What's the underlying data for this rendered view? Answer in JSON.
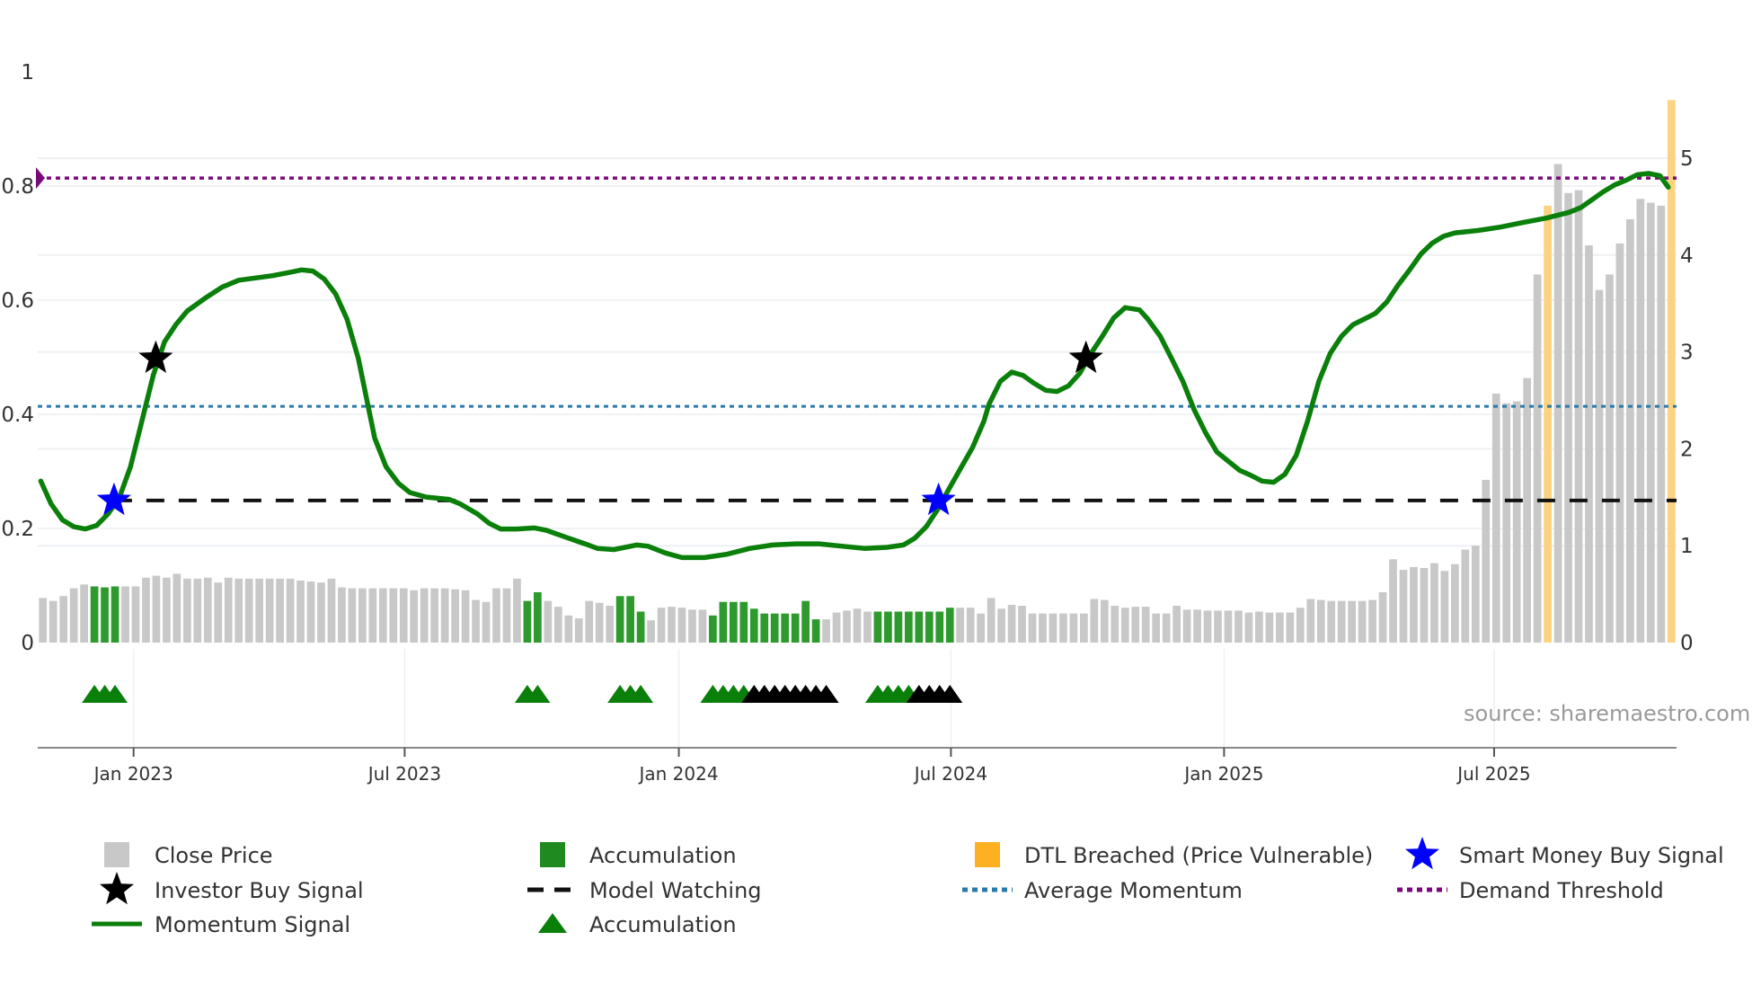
{
  "chart_data": {
    "type": "bar+line",
    "title": "",
    "x_unit": "week index",
    "x_ticks": [
      {
        "label": "Jan 2023",
        "x": 8.8
      },
      {
        "label": "Jul 2023",
        "x": 35.1
      },
      {
        "label": "Jan 2024",
        "x": 61.7
      },
      {
        "label": "Jul 2024",
        "x": 88.1
      },
      {
        "label": "Jan 2025",
        "x": 114.6
      },
      {
        "label": "Jul 2025",
        "x": 140.8
      }
    ],
    "left_axis": {
      "ylim": [
        0,
        1
      ],
      "ticks": [
        "0",
        "0.2",
        "0.4",
        "0.6",
        "0.8",
        "1"
      ],
      "tick_values": [
        0,
        0.2,
        0.4,
        0.6,
        0.8,
        1
      ]
    },
    "right_axis": {
      "ylim": [
        0,
        5.6
      ],
      "ticks": [
        "0",
        "1",
        "2",
        "3",
        "4",
        "5"
      ],
      "tick_values": [
        0,
        1,
        2,
        3,
        4,
        5
      ]
    },
    "bars": {
      "values": [
        0.46,
        0.43,
        0.48,
        0.56,
        0.6,
        0.58,
        0.57,
        0.58,
        0.58,
        0.58,
        0.67,
        0.69,
        0.67,
        0.71,
        0.66,
        0.66,
        0.67,
        0.62,
        0.67,
        0.66,
        0.66,
        0.66,
        0.66,
        0.66,
        0.66,
        0.64,
        0.63,
        0.62,
        0.66,
        0.57,
        0.56,
        0.56,
        0.56,
        0.56,
        0.56,
        0.56,
        0.54,
        0.56,
        0.56,
        0.56,
        0.55,
        0.54,
        0.44,
        0.42,
        0.56,
        0.56,
        0.66,
        0.43,
        0.52,
        0.43,
        0.37,
        0.28,
        0.25,
        0.43,
        0.41,
        0.38,
        0.48,
        0.48,
        0.32,
        0.23,
        0.36,
        0.37,
        0.36,
        0.34,
        0.34,
        0.28,
        0.42,
        0.42,
        0.42,
        0.35,
        0.3,
        0.3,
        0.3,
        0.3,
        0.43,
        0.24,
        0.24,
        0.31,
        0.33,
        0.35,
        0.32,
        0.32,
        0.32,
        0.32,
        0.32,
        0.32,
        0.32,
        0.32,
        0.36,
        0.36,
        0.36,
        0.3,
        0.46,
        0.35,
        0.39,
        0.38,
        0.3,
        0.3,
        0.3,
        0.3,
        0.3,
        0.3,
        0.45,
        0.44,
        0.38,
        0.36,
        0.37,
        0.37,
        0.3,
        0.3,
        0.38,
        0.34,
        0.34,
        0.33,
        0.33,
        0.33,
        0.33,
        0.31,
        0.32,
        0.31,
        0.31,
        0.31,
        0.36,
        0.45,
        0.44,
        0.43,
        0.43,
        0.43,
        0.43,
        0.44,
        0.52,
        0.86,
        0.75,
        0.78,
        0.77,
        0.82,
        0.74,
        0.81,
        0.96,
        1.0,
        1.68,
        2.57,
        2.47,
        2.49,
        2.73,
        3.8,
        4.51,
        4.94,
        4.64,
        4.67,
        4.1,
        3.64,
        3.8,
        4.12,
        4.37,
        4.58,
        4.54,
        4.51,
        5.6
      ],
      "accumulation_idx": [
        5,
        6,
        7,
        47,
        48,
        56,
        57,
        58,
        65,
        66,
        67,
        68,
        69,
        70,
        71,
        72,
        73,
        74,
        75,
        81,
        82,
        83,
        84,
        85,
        86,
        87,
        88
      ],
      "dtl_breached_idx": [
        146,
        158
      ]
    },
    "accumulation_markers": {
      "green_idx": [
        5,
        6,
        7,
        47,
        48,
        56,
        57,
        58,
        65,
        66,
        67,
        68,
        81,
        82,
        83,
        84
      ],
      "black_idx": [
        69,
        70,
        71,
        72,
        73,
        74,
        75,
        76,
        85,
        86,
        87,
        88
      ]
    },
    "momentum": [
      [
        -0.2,
        0.283
      ],
      [
        0.8,
        0.243
      ],
      [
        1.9,
        0.215
      ],
      [
        3.0,
        0.203
      ],
      [
        4.1,
        0.199
      ],
      [
        5.2,
        0.205
      ],
      [
        6.3,
        0.225
      ],
      [
        7.4,
        0.253
      ],
      [
        8.5,
        0.308
      ],
      [
        9.6,
        0.388
      ],
      [
        10.7,
        0.468
      ],
      [
        11.8,
        0.527
      ],
      [
        12.9,
        0.557
      ],
      [
        14.0,
        0.581
      ],
      [
        15.7,
        0.603
      ],
      [
        17.4,
        0.623
      ],
      [
        19.0,
        0.635
      ],
      [
        20.7,
        0.639
      ],
      [
        22.3,
        0.643
      ],
      [
        24.0,
        0.649
      ],
      [
        25.1,
        0.653
      ],
      [
        26.2,
        0.651
      ],
      [
        27.3,
        0.637
      ],
      [
        28.4,
        0.611
      ],
      [
        29.5,
        0.567
      ],
      [
        30.6,
        0.498
      ],
      [
        32.2,
        0.358
      ],
      [
        33.3,
        0.308
      ],
      [
        34.5,
        0.279
      ],
      [
        35.6,
        0.263
      ],
      [
        37.2,
        0.255
      ],
      [
        39.4,
        0.251
      ],
      [
        40.5,
        0.243
      ],
      [
        42.2,
        0.225
      ],
      [
        43.3,
        0.209
      ],
      [
        44.4,
        0.199
      ],
      [
        46.0,
        0.199
      ],
      [
        47.7,
        0.201
      ],
      [
        48.8,
        0.197
      ],
      [
        51.0,
        0.183
      ],
      [
        52.6,
        0.173
      ],
      [
        53.8,
        0.165
      ],
      [
        55.4,
        0.163
      ],
      [
        57.6,
        0.171
      ],
      [
        58.7,
        0.169
      ],
      [
        60.4,
        0.157
      ],
      [
        62.0,
        0.149
      ],
      [
        64.2,
        0.149
      ],
      [
        66.4,
        0.155
      ],
      [
        68.6,
        0.165
      ],
      [
        70.8,
        0.171
      ],
      [
        73.1,
        0.173
      ],
      [
        75.3,
        0.173
      ],
      [
        77.5,
        0.169
      ],
      [
        79.7,
        0.165
      ],
      [
        81.9,
        0.167
      ],
      [
        83.5,
        0.171
      ],
      [
        84.6,
        0.183
      ],
      [
        85.7,
        0.203
      ],
      [
        86.8,
        0.233
      ],
      [
        87.9,
        0.269
      ],
      [
        89.0,
        0.304
      ],
      [
        90.2,
        0.342
      ],
      [
        91.3,
        0.388
      ],
      [
        91.8,
        0.418
      ],
      [
        92.9,
        0.458
      ],
      [
        94.0,
        0.474
      ],
      [
        95.1,
        0.468
      ],
      [
        96.2,
        0.454
      ],
      [
        97.3,
        0.442
      ],
      [
        98.4,
        0.44
      ],
      [
        99.5,
        0.45
      ],
      [
        100.6,
        0.472
      ],
      [
        101.7,
        0.507
      ],
      [
        102.8,
        0.537
      ],
      [
        103.9,
        0.569
      ],
      [
        105.0,
        0.587
      ],
      [
        106.4,
        0.583
      ],
      [
        107.2,
        0.567
      ],
      [
        108.4,
        0.537
      ],
      [
        109.5,
        0.498
      ],
      [
        110.6,
        0.458
      ],
      [
        111.7,
        0.408
      ],
      [
        112.8,
        0.368
      ],
      [
        113.9,
        0.334
      ],
      [
        115.0,
        0.318
      ],
      [
        116.1,
        0.302
      ],
      [
        117.2,
        0.293
      ],
      [
        118.3,
        0.283
      ],
      [
        119.4,
        0.281
      ],
      [
        120.5,
        0.295
      ],
      [
        121.6,
        0.328
      ],
      [
        122.7,
        0.388
      ],
      [
        123.8,
        0.458
      ],
      [
        124.9,
        0.507
      ],
      [
        126.0,
        0.537
      ],
      [
        127.1,
        0.557
      ],
      [
        128.2,
        0.567
      ],
      [
        129.3,
        0.577
      ],
      [
        130.4,
        0.597
      ],
      [
        131.5,
        0.627
      ],
      [
        132.6,
        0.653
      ],
      [
        133.7,
        0.681
      ],
      [
        134.8,
        0.7
      ],
      [
        135.9,
        0.712
      ],
      [
        137.0,
        0.718
      ],
      [
        139.2,
        0.722
      ],
      [
        141.4,
        0.728
      ],
      [
        143.6,
        0.736
      ],
      [
        145.9,
        0.744
      ],
      [
        148.1,
        0.754
      ],
      [
        149.2,
        0.762
      ],
      [
        150.3,
        0.776
      ],
      [
        151.4,
        0.79
      ],
      [
        152.5,
        0.802
      ],
      [
        153.6,
        0.81
      ],
      [
        154.7,
        0.82
      ],
      [
        155.8,
        0.822
      ],
      [
        156.9,
        0.818
      ],
      [
        157.7,
        0.798
      ]
    ],
    "reference_lines": {
      "demand_threshold": 0.814,
      "average_momentum": 0.414,
      "model_watching": 0.249
    },
    "smart_money_buy_signals": [
      [
        6.9,
        0.249
      ],
      [
        86.9,
        0.249
      ]
    ],
    "investor_buy_signals": [
      [
        10.95,
        0.498
      ],
      [
        101.2,
        0.498
      ]
    ],
    "annotation": "source: sharemaestro.com",
    "legend": [
      {
        "label": "Close Price",
        "icon": "gray-square"
      },
      {
        "label": "Accumulation",
        "icon": "green-square"
      },
      {
        "label": "DTL Breached (Price Vulnerable)",
        "icon": "orange-square"
      },
      {
        "label": "Smart Money Buy Signal",
        "icon": "blue-star"
      },
      {
        "label": "Investor Buy Signal",
        "icon": "black-star"
      },
      {
        "label": "Model Watching",
        "icon": "black-dashed-line"
      },
      {
        "label": "Average Momentum",
        "icon": "blue-dotted-line"
      },
      {
        "label": "Demand Threshold",
        "icon": "purple-dotted-line"
      },
      {
        "label": "Momentum Signal",
        "icon": "green-line"
      },
      {
        "label": "Accumulation",
        "icon": "green-triangle"
      }
    ],
    "legend_placement": "bottom",
    "colors": {
      "close": "#c8c8c8",
      "accum": "#2e9a2e",
      "dtl": "#fdd281",
      "momentum": "#0a7f0a",
      "smart": "#0000ff",
      "avg": "#2a7aa8",
      "demand": "#7a0a7a",
      "tri_green": "#0a7f0a"
    }
  }
}
